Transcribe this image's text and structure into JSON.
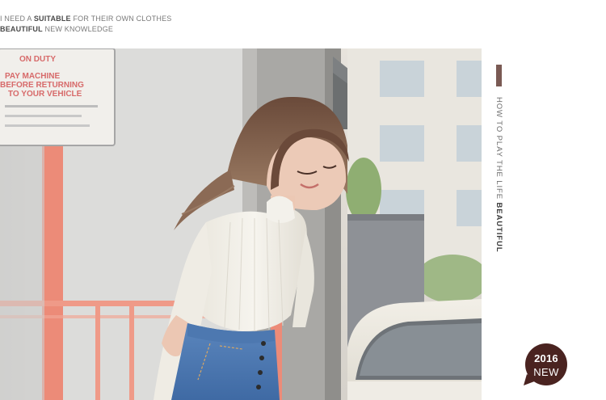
{
  "header": {
    "line1": {
      "pre": "I NEED A ",
      "bold": "SUITABLE",
      "post": " FOR THEIR OWN CLOTHES"
    },
    "line2": {
      "bold": "BEAUTIFUL",
      "post": " NEW KNOWLEDGE"
    }
  },
  "sign": {
    "lines": [
      "ON DUTY",
      "PAY MACHINE",
      "BEFORE RETURNING",
      "TO YOUR VEHICLE"
    ]
  },
  "side_panel": {
    "vertical_text": {
      "pre": "HOW TO PLAY THE LIFE ",
      "bold": "BEAUTIFUL"
    },
    "accent_color": "#7a5a54"
  },
  "badge": {
    "year": "2016",
    "label": "NEW",
    "color": "#4a2320"
  }
}
